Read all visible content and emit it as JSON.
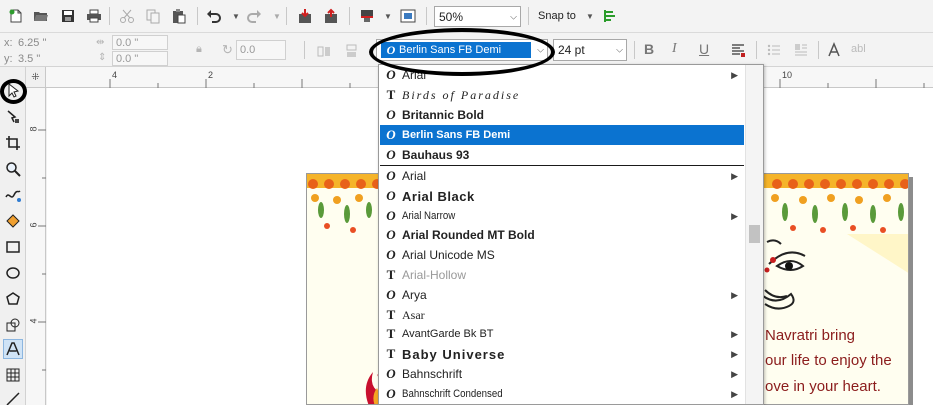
{
  "toolbar": {
    "zoom_value": "50%",
    "snap_label": "Snap to"
  },
  "property_bar": {
    "x_label": "x:",
    "x_value": "6.25 \"",
    "y_label": "y:",
    "y_value": "3.5 \"",
    "w_value": "0.0 \"",
    "h_value": "0.0 \"",
    "angle_value": "0.0",
    "font_name": "Berlin Sans FB Demi",
    "font_size": "24 pt",
    "bold_label": "B",
    "italic_label": "I",
    "underline_label": "U",
    "abl_label": "abl"
  },
  "ruler": {
    "h_ticks": [
      "4",
      "2",
      "10"
    ],
    "v_ticks": [
      "8",
      "6",
      "4"
    ]
  },
  "font_list": {
    "recent": [
      {
        "name": "Arial",
        "icon": "opentype-icon",
        "submenu": true
      },
      {
        "name": "Birds of Paradise",
        "icon": "truetype-icon",
        "submenu": false
      },
      {
        "name": "Britannic Bold",
        "icon": "opentype-icon",
        "submenu": false
      },
      {
        "name": "Berlin Sans FB Demi",
        "icon": "opentype-icon",
        "submenu": false,
        "selected": true
      },
      {
        "name": "Bauhaus 93",
        "icon": "opentype-icon",
        "submenu": false
      }
    ],
    "all": [
      {
        "name": "Arial",
        "icon": "opentype-icon",
        "submenu": true
      },
      {
        "name": "Arial Black",
        "icon": "opentype-icon",
        "submenu": false
      },
      {
        "name": "Arial Narrow",
        "icon": "opentype-icon",
        "submenu": true
      },
      {
        "name": "Arial Rounded MT Bold",
        "icon": "opentype-icon",
        "submenu": false
      },
      {
        "name": "Arial Unicode MS",
        "icon": "opentype-icon",
        "submenu": false
      },
      {
        "name": "Arial-Hollow",
        "icon": "truetype-icon",
        "submenu": false
      },
      {
        "name": "Arya",
        "icon": "opentype-icon",
        "submenu": true
      },
      {
        "name": "Asar",
        "icon": "truetype-icon",
        "submenu": false
      },
      {
        "name": "AvantGarde Bk BT",
        "icon": "truetype-icon",
        "submenu": true
      },
      {
        "name": "Baby Universe",
        "icon": "truetype-icon",
        "submenu": true
      },
      {
        "name": "Bahnschrift",
        "icon": "opentype-icon",
        "submenu": true
      },
      {
        "name": "Bahnschrift Condensed",
        "icon": "opentype-icon",
        "submenu": true
      }
    ]
  },
  "canvas": {
    "card_lines": [
      "Navratri bring",
      "our life to enjoy the",
      "ove in your heart."
    ]
  },
  "colors": {
    "selection": "#0b73d0",
    "card_text": "#8b1c1c"
  }
}
